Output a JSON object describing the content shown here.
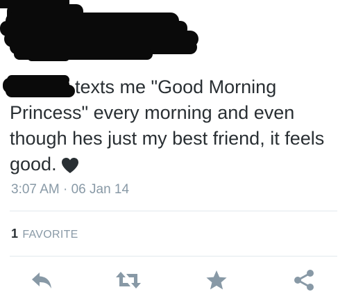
{
  "tweet": {
    "text_first_line": "texts me \"Good Morning",
    "text_rest": "Princess\" every morning and even though hes just my best friend, it feels good.",
    "emoji": "black-heart-icon",
    "timestamp": "3:07 AM · 06 Jan 14"
  },
  "stats": {
    "favorites_count": "1",
    "favorites_label": "FAVORITE"
  },
  "actions": {
    "reply_icon": "reply-icon",
    "retweet_icon": "retweet-icon",
    "favorite_icon": "star-icon",
    "share_icon": "share-icon"
  },
  "colors": {
    "text": "#292f33",
    "muted": "#8899a6",
    "divider": "#e1e8ed",
    "icon": "#8899a6",
    "redaction": "#0a0a0a"
  }
}
